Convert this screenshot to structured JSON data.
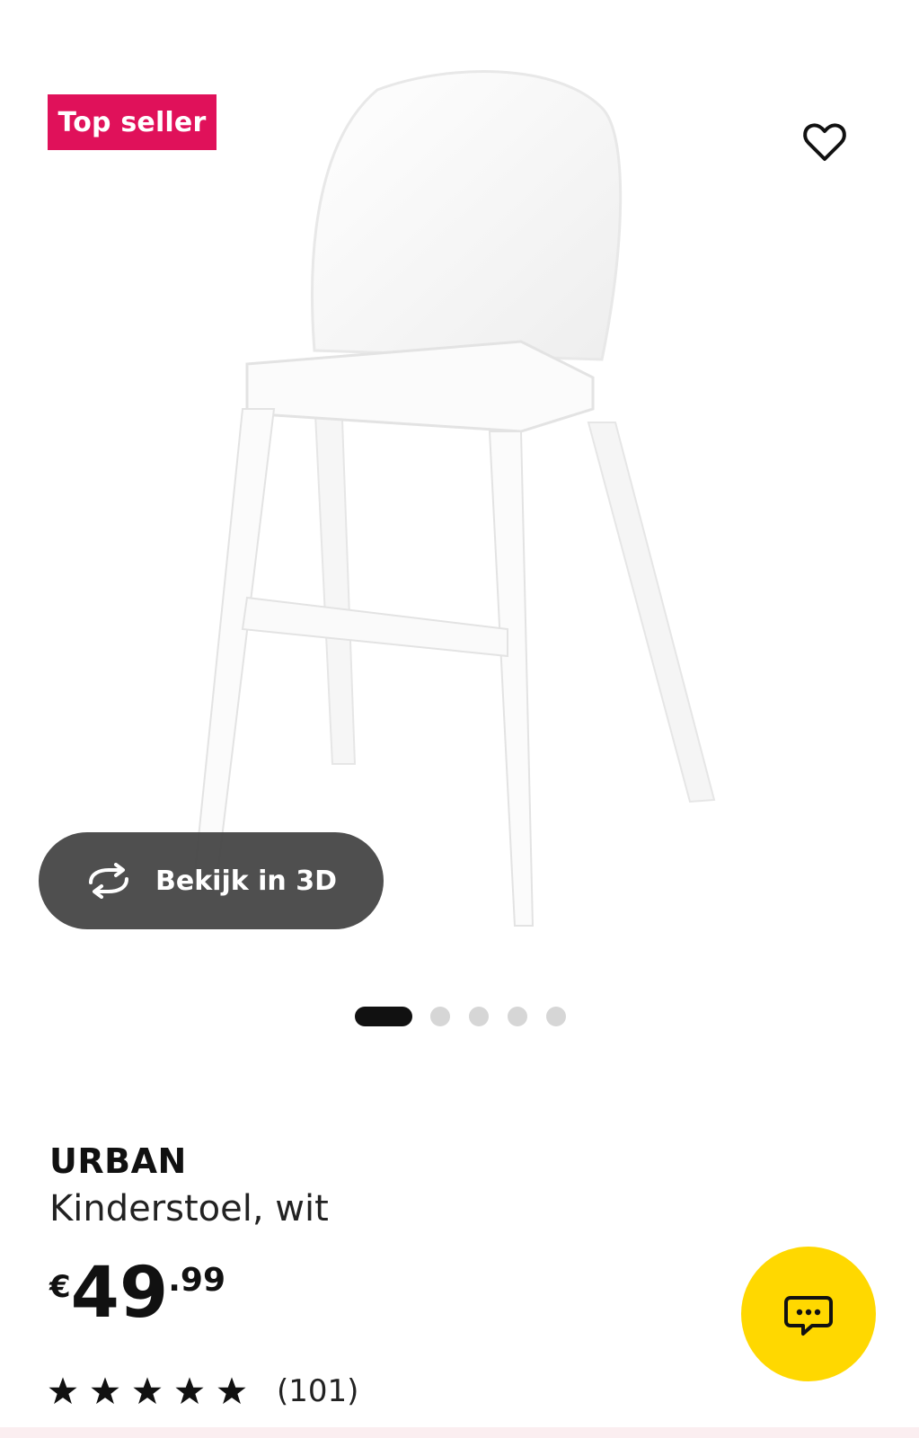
{
  "gallery": {
    "badge": "Top seller",
    "view3d_label": "Bekijk in 3D",
    "favourite_icon": "heart-outline-icon",
    "rotate_icon": "rotate-3d-icon",
    "image_count": 5,
    "active_image": 1
  },
  "product": {
    "brand": "URBAN",
    "description": "Kinderstoel, wit",
    "price": {
      "currency": "€",
      "integer": "49",
      "decimal": ".99"
    },
    "rating": {
      "stars": 5,
      "max": 5,
      "count_label": "(101)"
    }
  },
  "chat": {
    "icon": "chat-bubble-icon",
    "color": "#ffd800"
  },
  "colors": {
    "badge": "#e0115a",
    "accent": "#ffd800",
    "button_bg": "#484848"
  }
}
